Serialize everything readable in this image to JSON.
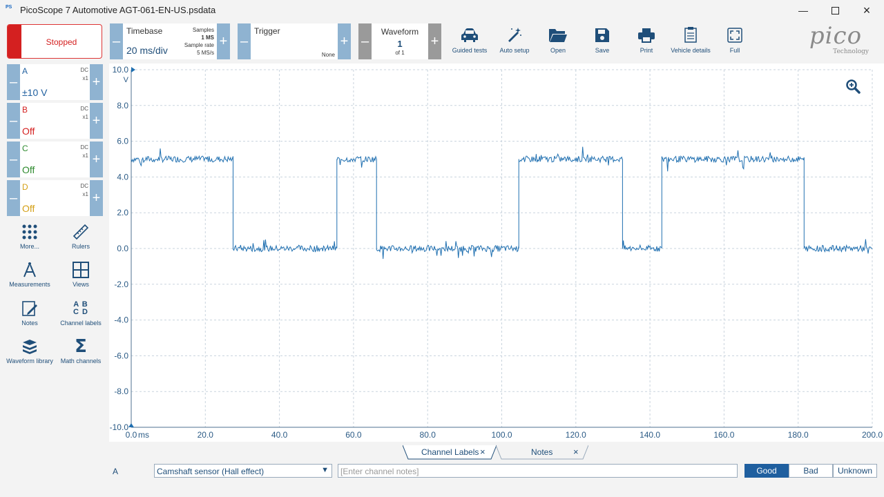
{
  "window": {
    "title": "PicoScope 7 Automotive AGT-061-EN-US.psdata",
    "icon_text": "PS"
  },
  "status": {
    "label": "Stopped"
  },
  "timebase": {
    "label": "Timebase",
    "value": "20 ms/div",
    "samples_label": "Samples",
    "samples_value": "1 MS",
    "rate_label": "Sample rate",
    "rate_value": "5 MS/s"
  },
  "trigger": {
    "label": "Trigger",
    "mode": "None"
  },
  "waveform": {
    "label": "Waveform",
    "current": "1",
    "of": "of 1"
  },
  "toolbar": [
    {
      "label": "Guided tests",
      "icon": "car-icon"
    },
    {
      "label": "Auto setup",
      "icon": "magic-wand-icon"
    },
    {
      "label": "Open",
      "icon": "folder-open-icon"
    },
    {
      "label": "Save",
      "icon": "save-icon"
    },
    {
      "label": "Print",
      "icon": "printer-icon"
    },
    {
      "label": "Vehicle details",
      "icon": "clipboard-icon"
    },
    {
      "label": "Full",
      "icon": "fullscreen-icon"
    }
  ],
  "logo": {
    "text": "pico",
    "sub": "Technology"
  },
  "channels": [
    {
      "letter": "A",
      "coupling": "DC",
      "probe": "x1",
      "range": "±10 V",
      "color": "#1f5f9f"
    },
    {
      "letter": "B",
      "coupling": "DC",
      "probe": "x1",
      "range": "Off",
      "color": "#d42020"
    },
    {
      "letter": "C",
      "coupling": "DC",
      "probe": "x1",
      "range": "Off",
      "color": "#2e8b2e"
    },
    {
      "letter": "D",
      "coupling": "DC",
      "probe": "x1",
      "range": "Off",
      "color": "#d4a017"
    }
  ],
  "side_tools": [
    {
      "label": "More...",
      "icon": "dots-grid-icon"
    },
    {
      "label": "Rulers",
      "icon": "ruler-icon"
    },
    {
      "label": "Measurements",
      "icon": "compass-icon"
    },
    {
      "label": "Views",
      "icon": "view-grid-icon"
    },
    {
      "label": "Notes",
      "icon": "note-pencil-icon"
    },
    {
      "label": "Channel labels",
      "icon": "abcd-icon"
    },
    {
      "label": "Waveform library",
      "icon": "books-icon"
    },
    {
      "label": "Math channels",
      "icon": "sigma-icon"
    }
  ],
  "chart_data": {
    "type": "line",
    "xlabel": "ms",
    "ylabel": "V",
    "xlim": [
      0,
      200
    ],
    "ylim": [
      -10,
      10
    ],
    "x_ticks": [
      "0.0",
      "20.0",
      "40.0",
      "60.0",
      "80.0",
      "100.0",
      "120.0",
      "140.0",
      "160.0",
      "180.0",
      "200.0"
    ],
    "y_ticks": [
      "10.0",
      "8.0",
      "6.0",
      "4.0",
      "2.0",
      "0.0",
      "-2.0",
      "-4.0",
      "-6.0",
      "-8.0",
      "-10.0"
    ],
    "grid": true,
    "series": [
      {
        "color": "#1f6fb0",
        "x": [
          0,
          27.5,
          27.5,
          55.5,
          55.5,
          66.2,
          66.2,
          104.6,
          104.6,
          132.6,
          132.6,
          143.2,
          143.2,
          181.6,
          181.6,
          200
        ],
        "y": [
          5.0,
          5.0,
          0.0,
          0.0,
          5.0,
          5.0,
          0.0,
          0.0,
          5.0,
          5.0,
          0.0,
          0.0,
          5.0,
          5.0,
          0.0,
          0.0
        ]
      }
    ]
  },
  "bottom": {
    "tabs": [
      {
        "label": "Channel Labels"
      },
      {
        "label": "Notes"
      }
    ],
    "channel": "A",
    "sensor": "Camshaft sensor (Hall effect)",
    "notes_placeholder": "[Enter channel notes]",
    "ratings": [
      "Good",
      "Bad",
      "Unknown"
    ],
    "rating_selected": "Good"
  }
}
